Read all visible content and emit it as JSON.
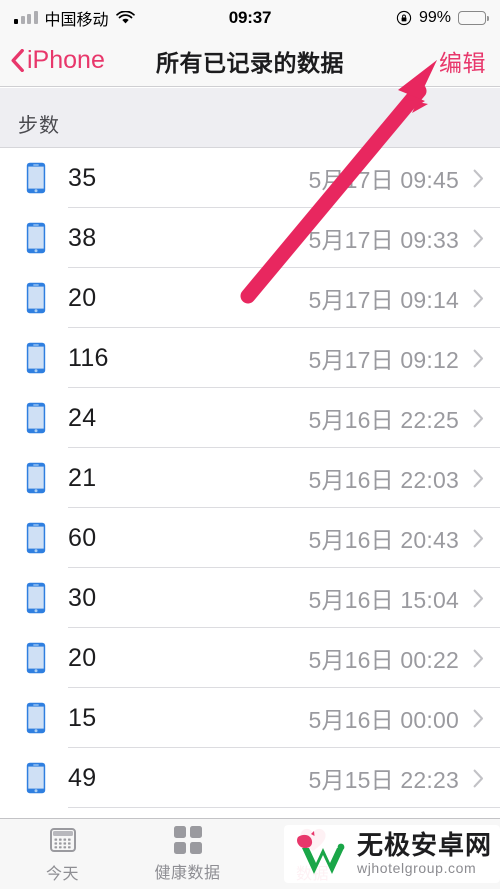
{
  "status_bar": {
    "carrier": "中国移动",
    "wifi_icon": "wifi-icon",
    "signal_icon": "cellular-signal-icon",
    "time": "09:37",
    "rotation_lock_icon": "rotation-lock-icon",
    "battery_percent": "99%",
    "battery_icon": "battery-full-icon"
  },
  "nav_bar": {
    "back_label": "iPhone",
    "back_chevron_icon": "chevron-left-icon",
    "title": "所有已记录的数据",
    "edit_label": "编辑",
    "tint_color": "#e8376b"
  },
  "list": {
    "section_header": "步数",
    "source_icon": "iphone-device-icon",
    "disclosure_icon": "chevron-right-icon",
    "rows": [
      {
        "value": "35",
        "date": "5月17日 09:45"
      },
      {
        "value": "38",
        "date": "5月17日 09:33"
      },
      {
        "value": "20",
        "date": "5月17日 09:14"
      },
      {
        "value": "116",
        "date": "5月17日 09:12"
      },
      {
        "value": "24",
        "date": "5月16日 22:25"
      },
      {
        "value": "21",
        "date": "5月16日 22:03"
      },
      {
        "value": "60",
        "date": "5月16日 20:43"
      },
      {
        "value": "30",
        "date": "5月16日 15:04"
      },
      {
        "value": "20",
        "date": "5月16日 00:22"
      },
      {
        "value": "15",
        "date": "5月16日 00:00"
      },
      {
        "value": "49",
        "date": "5月15日 22:23"
      }
    ]
  },
  "tab_bar": {
    "tabs": [
      {
        "label": "今天",
        "icon": "calendar-today-icon"
      },
      {
        "label": "健康数据",
        "icon": "health-data-grid-icon"
      },
      {
        "label": "数据",
        "icon": "sources-heart-icon"
      }
    ]
  },
  "annotation": {
    "arrow_icon": "red-arrow-annotation",
    "arrow_color": "#e8275f"
  },
  "watermark": {
    "logo_icon": "w-logo-icon",
    "title": "无极安卓网",
    "url": "wjhotelgroup.com"
  }
}
